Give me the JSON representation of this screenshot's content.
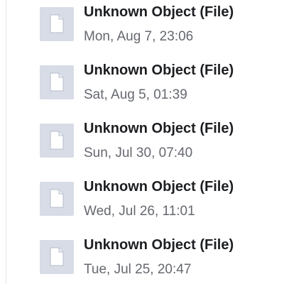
{
  "items": [
    {
      "title": "Unknown Object (File)",
      "date": "Mon, Aug 7, 23:06",
      "icon": "file-icon"
    },
    {
      "title": "Unknown Object (File)",
      "date": "Sat, Aug 5, 01:39",
      "icon": "file-icon"
    },
    {
      "title": "Unknown Object (File)",
      "date": "Sun, Jul 30, 07:40",
      "icon": "file-icon"
    },
    {
      "title": "Unknown Object (File)",
      "date": "Wed, Jul 26, 11:01",
      "icon": "file-icon"
    },
    {
      "title": "Unknown Object (File)",
      "date": "Tue, Jul 25, 20:47",
      "icon": "file-icon"
    }
  ],
  "colors": {
    "thumb_bg": "#d7dce6",
    "title": "#1c1e21",
    "date": "#65686f"
  }
}
